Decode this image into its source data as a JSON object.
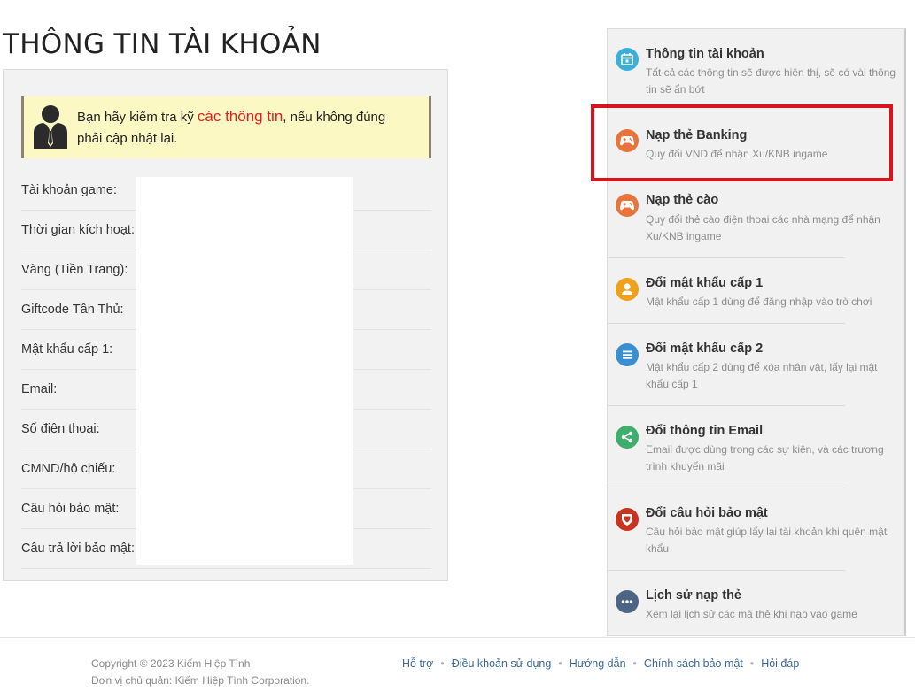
{
  "page_title": "THÔNG TIN TÀI KHOẢN",
  "notice": {
    "before": "Bạn hãy kiểm tra kỹ ",
    "highlight": "các thông tin",
    "after": ", nếu không đúng phải cập nhật lại."
  },
  "fields": [
    {
      "label": "Tài khoản game:"
    },
    {
      "label": "Thời gian kích hoạt:"
    },
    {
      "label": "Vàng (Tiền Trang):"
    },
    {
      "label": "Giftcode Tân Thủ:"
    },
    {
      "label": "Mật khẩu cấp 1:"
    },
    {
      "label": "Email:"
    },
    {
      "label": "Số điện thoại:"
    },
    {
      "label": "CMND/hộ chiếu:"
    },
    {
      "label": "Câu hỏi bảo mật:"
    },
    {
      "label": "Câu trả lời bảo mật:"
    }
  ],
  "sidebar": {
    "items": [
      {
        "title": "Thông tin tài khoản",
        "desc": "Tất cả các thông tin sẽ được hiện thị, sẽ có vài thông tin sẽ ẩn bớt",
        "icon": "calendar-icon",
        "color": "#3ab0d9"
      },
      {
        "title": "Nạp thẻ Banking",
        "desc": "Quy đổi VND để nhận Xu/KNB ingame",
        "icon": "gamepad-icon",
        "color": "#e8743b"
      },
      {
        "title": "Nạp thẻ cào",
        "desc": "Quy đổi thẻ cào điện thoại các nhà mạng để nhận Xu/KNB ingame",
        "icon": "gamepad-icon",
        "color": "#e8743b"
      },
      {
        "title": "Đổi mật khẩu cấp 1",
        "desc": "Mật khẩu cấp 1 dùng để đăng nhập vào trò chơi",
        "icon": "user-icon",
        "color": "#f0a11b"
      },
      {
        "title": "Đổi mật khẩu cấp 2",
        "desc": "Mật khẩu cấp 2 dùng để xóa nhân vật, lấy lại mật khẩu cấp 1",
        "icon": "menu-icon",
        "color": "#3b8fd1"
      },
      {
        "title": "Đổi thông tin Email",
        "desc": "Email được dùng trong các sự kiện, và các trương trình khuyến mãi",
        "icon": "share-icon",
        "color": "#3dae6b"
      },
      {
        "title": "Đổi câu hỏi bảo mật",
        "desc": "Câu hỏi bảo mật giúp lấy lại tài khoản khi quên mật khẩu",
        "icon": "shield-icon",
        "color": "#c9341f"
      },
      {
        "title": "Lịch sử nạp thẻ",
        "desc": "Xem lại lịch sử các mã thẻ khi nạp vào game",
        "icon": "more-icon",
        "color": "#4d6585"
      }
    ]
  },
  "footer": {
    "copyright": "Copyright © 2023 Kiếm Hiệp Tình",
    "owner": "Đơn vị chủ quản: Kiếm Hiệp Tình Corporation.",
    "links": [
      "Hỗ trợ",
      "Điều khoản sử dụng",
      "Hướng dẫn",
      "Chính sách bảo mật",
      "Hỏi đáp"
    ]
  }
}
